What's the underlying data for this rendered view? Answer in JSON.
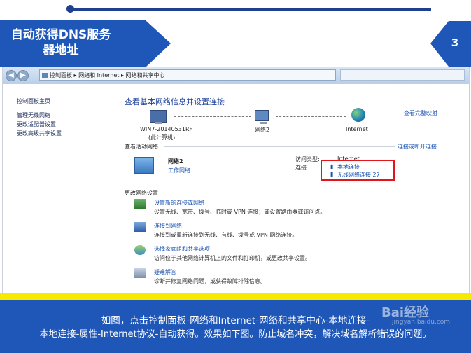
{
  "slide": {
    "title": "自动获得DNS服务器地址",
    "page_number": "3",
    "caption_line1": "如图，点击控制面板-网络和Internet-网络和共享中心-本地连接-",
    "caption_line2": "本地连接-属性-Internet协议-自动获得。效果如下图。防止域名冲突，解决域名解析错误的问题。",
    "watermark": "Bai经验",
    "watermark_sub": "jingyan.baidu.com"
  },
  "window": {
    "breadcrumb": [
      "控制面板",
      "网络和 Internet",
      "网络和共享中心"
    ],
    "breadcrumb_sep": "▸"
  },
  "sidebar": {
    "items": [
      {
        "label": "控制面板主页"
      },
      {
        "label": "管理无线网络"
      },
      {
        "label": "更改适配器设置"
      },
      {
        "label": "更改高级共享设置"
      }
    ]
  },
  "main": {
    "heading": "查看基本网络信息并设置连接",
    "view_full_map": "查看完整映射",
    "map": {
      "computer_name": "WIN7-20140531RF",
      "computer_sub": "(此计算机)",
      "network": "网络2",
      "internet": "Internet"
    },
    "active_networks_title": "查看活动网络",
    "connect_disconnect": "连接或断开连接",
    "active": {
      "name": "网络2",
      "type": "工作网络",
      "access_type_label": "访问类型:",
      "access_type_value": "Internet",
      "connections_label": "连接:",
      "connection_1": "本地连接",
      "connection_2": "无线网络连接 27"
    },
    "change_settings_title": "更改网络设置",
    "tasks": [
      {
        "link": "设置新的连接或网络",
        "desc": "设置无线、宽带、拨号、临时或 VPN 连接；或设置路由器或访问点。"
      },
      {
        "link": "连接到网络",
        "desc": "连接到或重新连接到无线、有线、拨号或 VPN 网络连接。"
      },
      {
        "link": "选择家庭组和共享选项",
        "desc": "访问位于其他网络计算机上的文件和打印机，或更改共享设置。"
      },
      {
        "link": "疑难解答",
        "desc": "诊断并修复网络问题，或获得故障排除信息。"
      }
    ]
  },
  "colors": {
    "brand_blue": "#1f57b8",
    "accent_yellow": "#f7ea00",
    "highlight_red": "#e0161b"
  }
}
